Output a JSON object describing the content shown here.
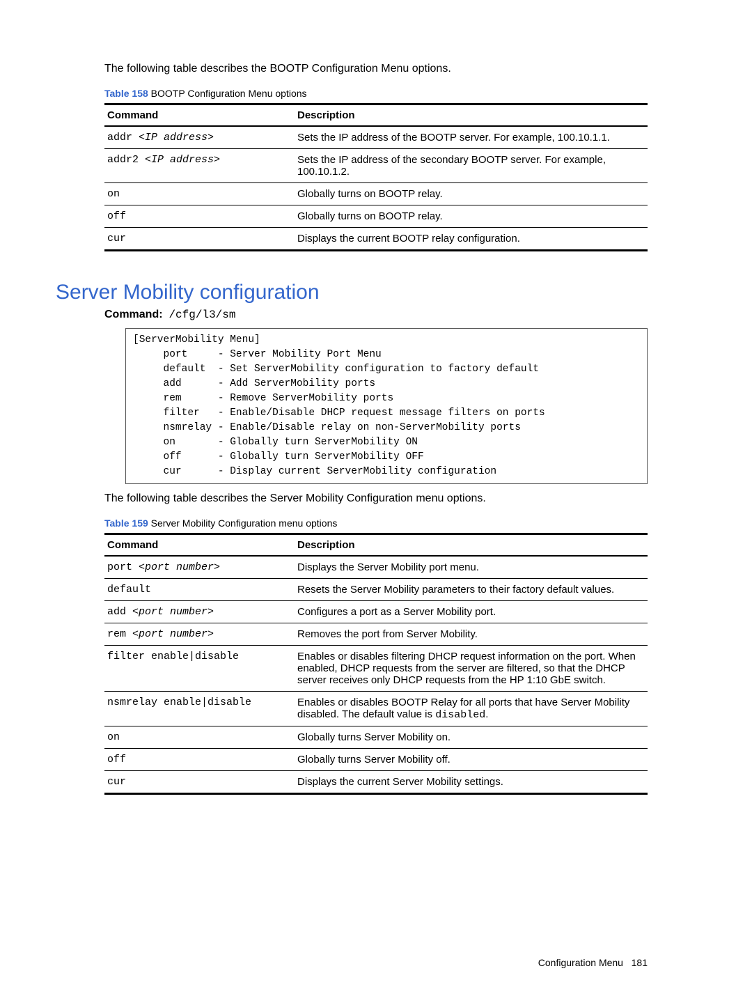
{
  "intro1": "The following table describes the BOOTP Configuration Menu options.",
  "table158": {
    "label": "Table 158",
    "caption": "  BOOTP Configuration Menu options",
    "headers": {
      "cmd": "Command",
      "desc": "Description"
    },
    "rows": [
      {
        "cmd": "addr ",
        "arg": "<IP address>",
        "desc": "Sets the IP address of the BOOTP server. For example, 100.10.1.1."
      },
      {
        "cmd": "addr2 ",
        "arg": "<IP address>",
        "desc": "Sets the IP address of the secondary BOOTP server. For example, 100.10.1.2."
      },
      {
        "cmd": "on",
        "arg": "",
        "desc": "Globally turns on BOOTP relay."
      },
      {
        "cmd": "off",
        "arg": "",
        "desc": "Globally turns on BOOTP relay."
      },
      {
        "cmd": "cur",
        "arg": "",
        "desc": "Displays the current BOOTP relay configuration."
      }
    ]
  },
  "section_heading": "Server Mobility configuration",
  "cmd_label": "Command:",
  "cmd_value": "/cfg/l3/sm",
  "menu_box": "[ServerMobility Menu]\n     port     - Server Mobility Port Menu\n     default  - Set ServerMobility configuration to factory default\n     add      - Add ServerMobility ports\n     rem      - Remove ServerMobility ports\n     filter   - Enable/Disable DHCP request message filters on ports\n     nsmrelay - Enable/Disable relay on non-ServerMobility ports\n     on       - Globally turn ServerMobility ON\n     off      - Globally turn ServerMobility OFF\n     cur      - Display current ServerMobility configuration",
  "intro2": "The following table describes the Server Mobility Configuration menu options.",
  "table159": {
    "label": "Table 159",
    "caption": "  Server Mobility Configuration menu options",
    "headers": {
      "cmd": "Command",
      "desc": "Description"
    },
    "rows": [
      {
        "cmd": "port ",
        "arg": "<port number>",
        "desc": "Displays the Server Mobility port menu."
      },
      {
        "cmd": "default",
        "arg": "",
        "desc": "Resets the Server Mobility parameters to their factory default values."
      },
      {
        "cmd": "add ",
        "arg": "<port number>",
        "desc": "Configures a port as a Server Mobility port."
      },
      {
        "cmd": "rem ",
        "arg": "<port number>",
        "desc": "Removes the port from Server Mobility."
      },
      {
        "cmd": "filter enable|disable",
        "arg": "",
        "desc": "Enables or disables filtering DHCP request information on the port. When enabled, DHCP requests from the server are filtered, so that the DHCP server receives only DHCP requests from the HP 1:10 GbE switch."
      },
      {
        "cmd": "nsmrelay enable|disable",
        "arg": "",
        "desc_pre": "Enables or disables BOOTP Relay for all ports that have Server Mobility disabled. The default value is ",
        "desc_mono": "disabled",
        "desc_post": "."
      },
      {
        "cmd": "on",
        "arg": "",
        "desc": "Globally turns Server Mobility on."
      },
      {
        "cmd": "off",
        "arg": "",
        "desc": "Globally turns Server Mobility off."
      },
      {
        "cmd": "cur",
        "arg": "",
        "desc": "Displays the current Server Mobility settings."
      }
    ]
  },
  "footer": {
    "text": "Configuration Menu",
    "page": "181"
  }
}
